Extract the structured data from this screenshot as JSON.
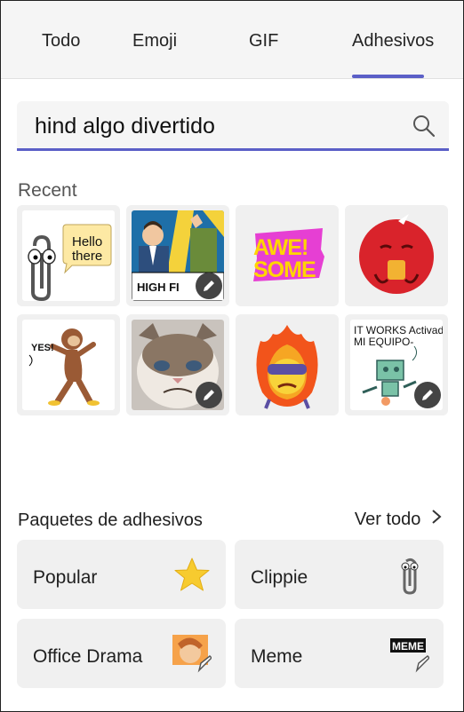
{
  "tabs": [
    {
      "label": "Todo"
    },
    {
      "label": "Emoji"
    },
    {
      "label": "GIF"
    },
    {
      "label": "Adhesivos",
      "active": true
    }
  ],
  "search": {
    "value": "hind algo divertido",
    "icon": "search-icon"
  },
  "recent": {
    "title": "Recent",
    "stickers": [
      {
        "name": "clippie-hello-there",
        "text": "Hello there"
      },
      {
        "name": "high-five-meme",
        "text": "HIGH FI",
        "editable": true
      },
      {
        "name": "awesome",
        "text": "AWE! SOME"
      },
      {
        "name": "red-monster-coffee"
      },
      {
        "name": "monkey-yes",
        "text": "YES!"
      },
      {
        "name": "grumpy-cat",
        "editable": true
      },
      {
        "name": "fire-character"
      },
      {
        "name": "it-works-robot",
        "text": "IT WORKS  Activado MI EQUIPO-",
        "editable": true
      }
    ]
  },
  "packs": {
    "title": "Paquetes de adhesivos",
    "see_all": "Ver todo",
    "items": [
      {
        "label": "Popular",
        "icon": "star-icon"
      },
      {
        "label": "Clippie",
        "icon": "paperclip-icon"
      },
      {
        "label": "Office Drama",
        "icon": "office-drama-icon"
      },
      {
        "label": "Meme",
        "icon": "meme-icon"
      }
    ]
  },
  "colors": {
    "accent": "#5b5fc7",
    "star": "#f7cb2f",
    "red_monster": "#d9232b",
    "awesome_pink": "#e63fd3",
    "awesome_yellow": "#ffd500"
  }
}
